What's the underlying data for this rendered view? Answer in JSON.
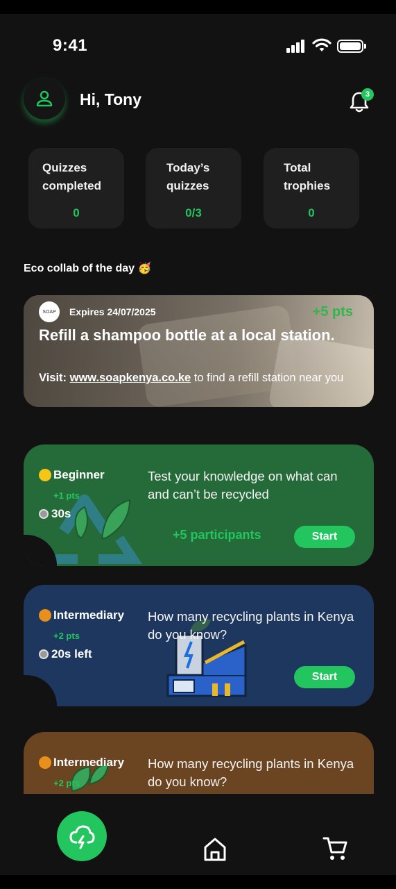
{
  "status_bar": {
    "time": "9:41"
  },
  "header": {
    "greeting": "Hi, Tony",
    "notification_count": "3"
  },
  "stats": [
    {
      "label": "Quizzes completed",
      "value": "0"
    },
    {
      "label": "Today’s quizzes",
      "value": "0/3"
    },
    {
      "label": "Total trophies",
      "value": "0"
    }
  ],
  "eco_collab": {
    "section_title": "Eco collab of the day 🥳",
    "logo_text": "SOAP",
    "expires": "Expires 24/07/2025",
    "points": "+5 pts",
    "title": "Refill a shampoo bottle at a local station.",
    "visit_label": "Visit:",
    "visit_link": "www.soapkenya.co.ke",
    "visit_rest": " to find a refill station near you"
  },
  "quizzes": [
    {
      "level": "Beginner",
      "level_color": "#f5c518",
      "card_color": "#256b3a",
      "points": "+1 pts",
      "timer": "30s",
      "question": "Test your knowledge on what can and can’t be recycled",
      "participants": "+5 participants",
      "start_label": "Start"
    },
    {
      "level": "Intermediary",
      "level_color": "#e8901c",
      "card_color": "#1d375f",
      "points": "+2 pts",
      "timer": "20s left",
      "question": "How many recycling plants in Kenya do you know?",
      "start_label": "Start"
    },
    {
      "level": "Intermediary",
      "level_color": "#e8901c",
      "card_color": "#6b4421",
      "points": "+2 pts",
      "question": "How many recycling plants in Kenya do you know?"
    }
  ],
  "colors": {
    "accent": "#22c55e",
    "background": "#121212",
    "card": "#1f1f1f"
  },
  "icons": [
    "user-icon",
    "bell-icon",
    "cloud-lightning-icon",
    "home-icon",
    "cart-icon"
  ]
}
